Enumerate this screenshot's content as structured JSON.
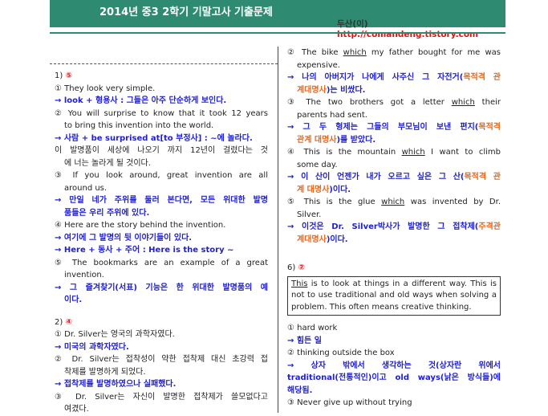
{
  "header": {
    "title": "2014년 중3 2학기 기말고사 기출문제",
    "author": "두산(이)",
    "url": "http://comandeng.tistory.com"
  },
  "left": {
    "q1": {
      "num": "1)",
      "answer": "⑤",
      "l1": "① They look very simple.",
      "l2": "→ look + 형용사 : 그들은 아주 단순하게 보인다.",
      "l3a": "② You will surprise to know that it took 12 years",
      "l3b": "to bring this invention into the world.",
      "l4": "→ 사람 + be surprised at[to 부정사] : ~에 놀라다.",
      "l5a": "이 발명품이 세상에 나오기 까지 12년이 걸렸다는 것",
      "l5b": "에 너는 놀라게 될 것이다.",
      "l6a": "③ If you look around, great invention are all",
      "l6b": "around us.",
      "l7a": "→ 만일 네가 주위를 둘러 본다면, 모든 위대한 발명",
      "l7b": "품들은 우리 주위에 있다.",
      "l8": "④ Here are the story behind the invention.",
      "l9": "→ 여기에 그 발명의 뒷 이야기들이 있다.",
      "l10": "→ Here + 동사 + 주어 : Here is the story ~",
      "l11a": "⑤ The bookmarks are an example of a great",
      "l11b": "invention.",
      "l12a": "→ 그 즐겨찾기(서표) 기능은 한 위대한 발명품의 예",
      "l12b": "이다."
    },
    "q2": {
      "num": "2)",
      "answer": "④",
      "l1": "① Dr. Silver는 영국의 과학자였다.",
      "l2": "→ 미국의 과학자였다.",
      "l3a": "② Dr. Silver는 접착성이 약한 접착제 대신 초강력 접",
      "l3b": "착제를 발명하게 되었다.",
      "l4": "→ 접착제를 발명하였으나 실패했다.",
      "l5": "③ Dr. Silver는 자신이 발명한 접착제가 쓸모없다고",
      "l5b": "여겼다."
    }
  },
  "right": {
    "r1a_pre": "② The bike ",
    "r1a_ul": "which",
    "r1a_post": " my father bought for me was",
    "r1b": "expensive.",
    "r2a_pre": "→ 나의 아버지가 나에게 사주신 그 자전거(",
    "r2a_or": "목적격 관",
    "r2b_or": "계대명사",
    "r2b_post": ")는 비쌌다.",
    "r3a_pre": "③ The two brothers got a letter ",
    "r3a_ul": "which",
    "r3a_post": " their",
    "r3b": "parents had sent.",
    "r4a_pre": "→ 그 두 형제는 그들의 부모님이 보낸 편지(",
    "r4a_or": "목적격",
    "r4b_or": "관계 대명사",
    "r4b_post": ")를 받았다.",
    "r5a_pre": "④ This is the mountain ",
    "r5a_ul": "which",
    "r5a_post": " I want to climb",
    "r5b": "some day.",
    "r6a_pre": "→ 이 산이 언젠가 내가 오르고 싶은 그 산(",
    "r6a_or": "목적격 관",
    "r6b_or": "계 대명사",
    "r6b_post": ")이다.",
    "r7a_pre": "⑤ This is the glue ",
    "r7a_ul": "which",
    "r7a_post": " was invented by Dr.",
    "r7b": "Silver.",
    "r8a_pre": "→ 이것은 Dr. Silver박사가 발명한 그 접착제(",
    "r8a_or": "주격관",
    "r8b_or": "계대명사",
    "r8b_post": ")이다.",
    "q6": {
      "num": "6)",
      "answer": "②",
      "box_ul": "This",
      "box_l1": " is to look at things in a different way. This is",
      "box_l2": "not to use traditional and old ways when solving a",
      "box_l3": "problem. This often means creative thinking.",
      "o1": "① hard work",
      "o1a": "→ 힘든 일",
      "o2": "② thinking outside the box",
      "o2a": "→ 상자 밖에서 생각하는 것(상자란 위에서",
      "o2b": "traditional(전통적인)이고 old ways(낡은 방식들)에",
      "o2c": "해당됨.",
      "o3": "③ Never give up without trying"
    }
  }
}
